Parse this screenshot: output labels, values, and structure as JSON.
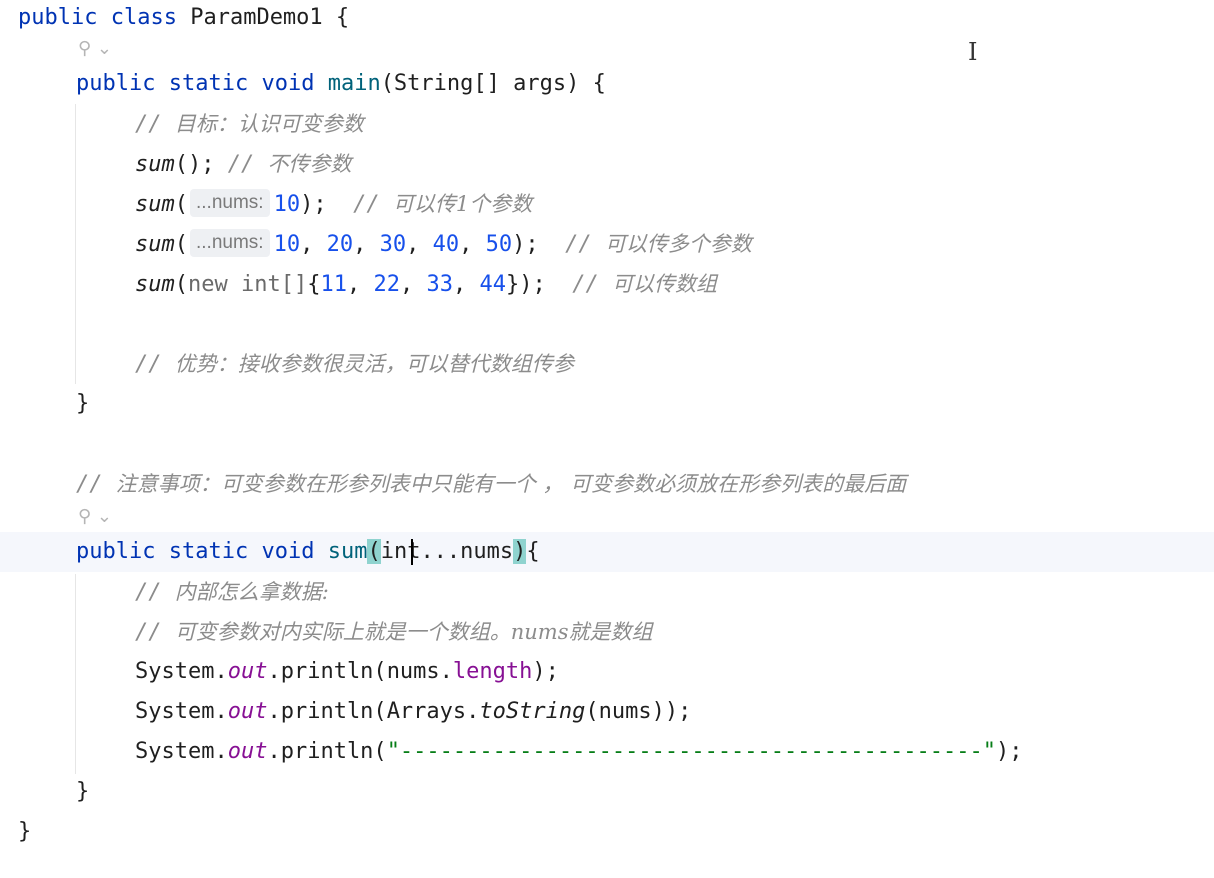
{
  "code": {
    "l1_kw1": "public",
    "l1_kw2": "class",
    "l1_name": "ParamDemo1",
    "l1_brace": "{",
    "usage_icon": "⚲",
    "usage_chevron": "⌄",
    "l3_kw1": "public",
    "l3_kw2": "static",
    "l3_kw3": "void",
    "l3_name": "main",
    "l3_rest": "(String[] args) {",
    "c1": "目标：认识可变参数",
    "call_sum": "sum",
    "l5_rest": "();",
    "c2": "不传参数",
    "hint_label": "...nums:",
    "l6_num": "10",
    "l6_end": ");",
    "c3": "可以传1个参数",
    "l7_nums": [
      "10",
      "20",
      "30",
      "40",
      "50"
    ],
    "l7_end": ");",
    "c4": "可以传多个参数",
    "l8_new": "new int[]",
    "l8_nums": [
      "11",
      "22",
      "33",
      "44"
    ],
    "l8_end": "});",
    "c5": "可以传数组",
    "c6": "优势：接收参数很灵活，可以替代数组传参",
    "close": "}",
    "c7": "注意事项：可变参数在形参列表中只能有一个 ， 可变参数必须放在形参列表的最后面",
    "l14_kw1": "public",
    "l14_kw2": "static",
    "l14_kw3": "void",
    "l14_name": "sum",
    "l14_param": "int...nums",
    "c8": "内部怎么拿数据:",
    "c9": "可变参数对内实际上就是一个数组。nums就是数组",
    "sys": "System.",
    "out": "out",
    "println": ".println(",
    "l17_arg": "nums.",
    "l17_len": "length",
    "l17_end": ");",
    "l18_arrays": "Arrays.",
    "l18_tostring": "toString",
    "l18_end": "(nums));",
    "l19_str": "\"--------------------------------------------\"",
    "l19_end": ");"
  }
}
